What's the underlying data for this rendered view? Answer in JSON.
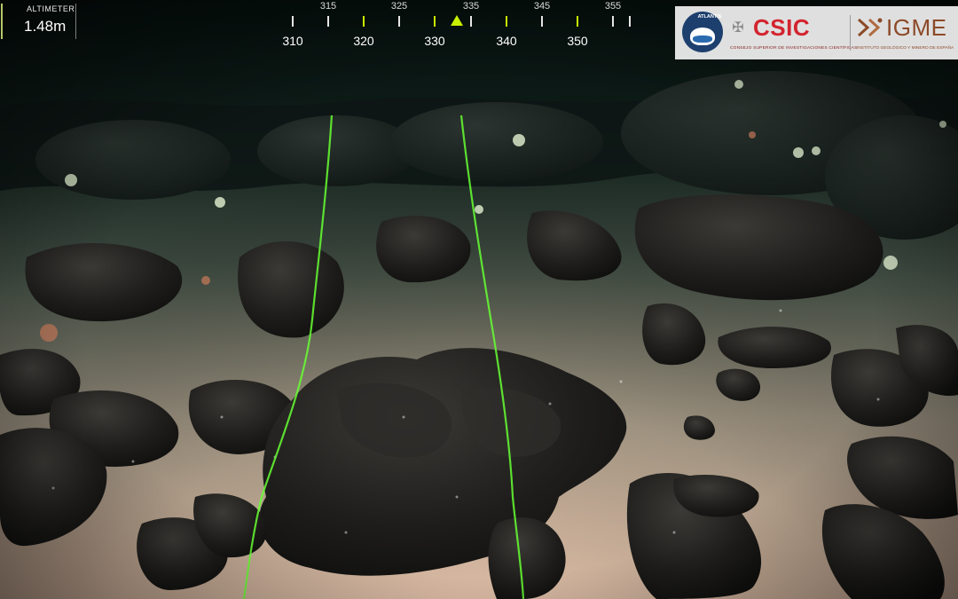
{
  "altimeter": {
    "label": "ALTIMETER",
    "value": "1.48m"
  },
  "compass": {
    "upper_labels": [
      "315",
      "325",
      "335",
      "345",
      "355"
    ],
    "lower_labels": [
      "310",
      "320",
      "330",
      "340",
      "350"
    ],
    "tick_color": "#e6e6e6",
    "accent_color": "#c8f000"
  },
  "logos": {
    "atlantis": {
      "text": "ATLANTIS",
      "icon": "atlantis-emblem-icon"
    },
    "csic": {
      "title": "CSIC",
      "subtitle": "CONSEJO SUPERIOR DE INVESTIGACIONES CIENTÍFICAS",
      "color": "#d3242f",
      "icon": "csic-crest-icon"
    },
    "igme": {
      "title": "IGME",
      "subtitle": "INSTITUTO GEOLÓGICO Y MINERO DE ESPAÑA",
      "color": "#8c4a28",
      "icon": "igme-mark-icon"
    }
  },
  "scene": {
    "description_icon": "seafloor-lava-rocks",
    "laser_color": "#66ff33",
    "sediment_color": "#c8b49a",
    "rock_color": "#1c1b1a"
  }
}
